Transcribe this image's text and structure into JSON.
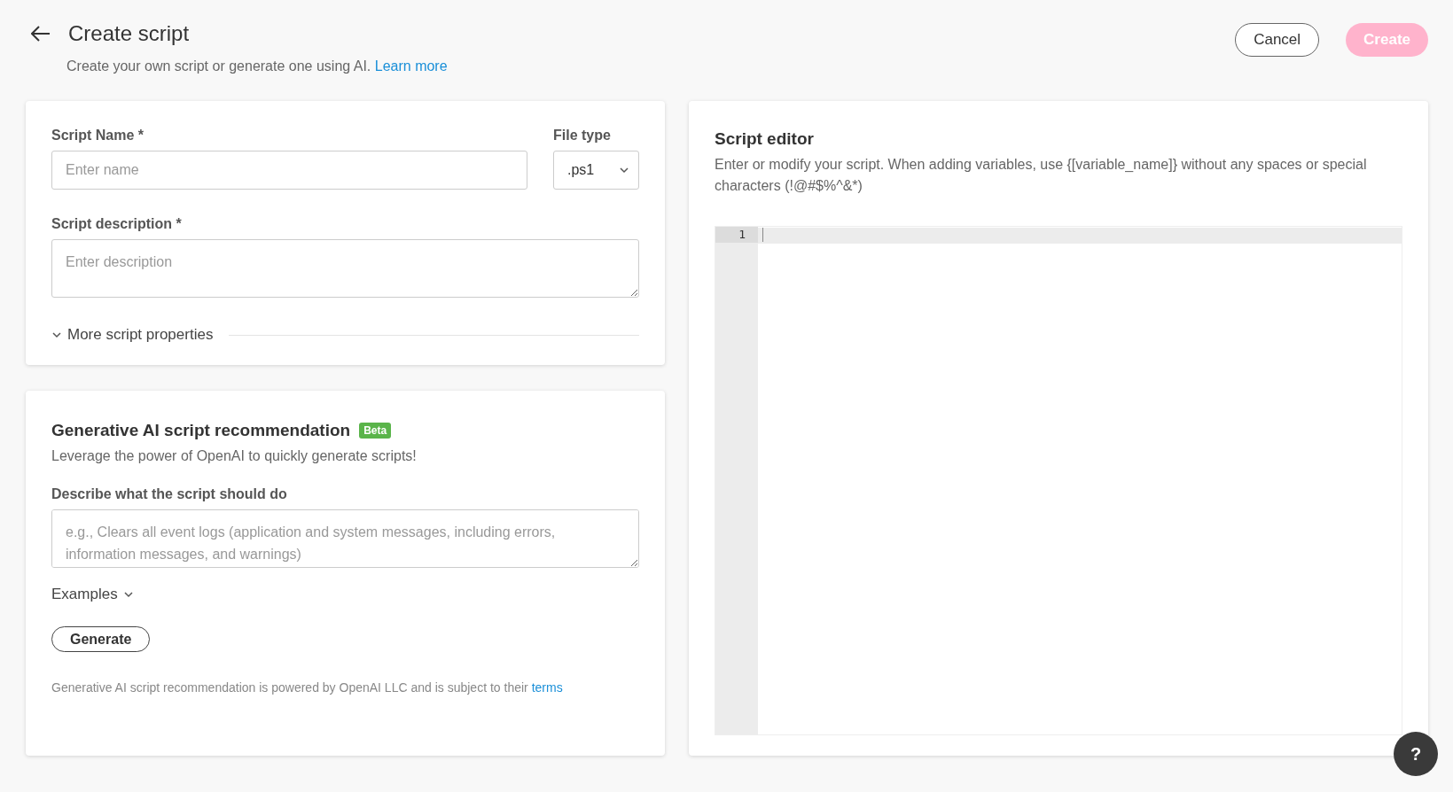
{
  "header": {
    "title": "Create script",
    "subtitle": "Create your own script or generate one using AI.",
    "subtitle_link": "Learn more"
  },
  "actions": [
    {
      "label": "Cancel",
      "kind": "outline",
      "disabled": false
    },
    {
      "label": "Create",
      "kind": "primary",
      "disabled": true
    }
  ],
  "details": {
    "name_label": "Script Name *",
    "name_placeholder": "Enter name",
    "file_type_label": "File type",
    "file_type_value": ".ps1",
    "description_label": "Script description *",
    "description_placeholder": "Enter description",
    "more_properties": "More script properties",
    "more_expanded": false
  },
  "ai": {
    "title": "Generative AI script recommendation",
    "badge": "Beta",
    "subtitle": "Leverage the power of OpenAI to quickly generate scripts!",
    "prompt_label": "Describe what the script should do",
    "prompt_placeholder": "e.g., Clears all event logs (application and system messages, including errors, information messages, and warnings)",
    "examples": "Examples",
    "examples_expanded": false,
    "generate": "Generate",
    "footer": "Generative AI script recommendation is powered by OpenAI LLC and is subject to their",
    "footer_link": "terms"
  },
  "editor": {
    "title": "Script editor",
    "description": "Enter or modify your script. When adding variables, use {[variable_name]} without any spaces or special characters (!@#$%^&*)",
    "line_numbers": [
      "1"
    ]
  },
  "help": {
    "label": "?"
  }
}
